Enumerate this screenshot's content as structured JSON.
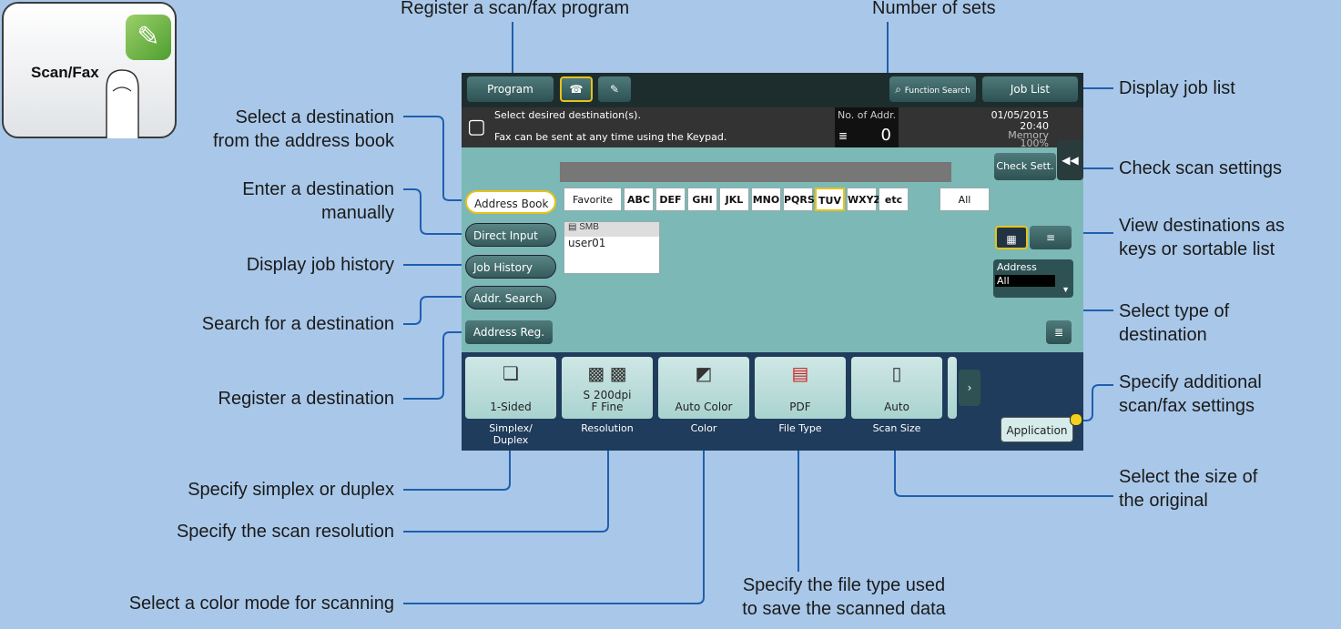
{
  "key": {
    "label": "Scan/Fax",
    "icon": "scan-fax-icon"
  },
  "toolbar": {
    "program": "Program",
    "function_search": "Function Search",
    "job_list": "Job List"
  },
  "message": {
    "line1": "Select desired destination(s).",
    "line2": "Fax can be sent at any time using the Keypad.",
    "no_of_addr_label": "No. of Addr.",
    "no_of_addr_value": "0",
    "date": "01/05/2015",
    "time": "20:40",
    "memory_label": "Memory",
    "memory_value": "100%"
  },
  "check_settings": "Check Sett.",
  "left_tabs": [
    "Address Book",
    "Direct Input",
    "Job History",
    "Addr. Search",
    "Address Reg."
  ],
  "index_tabs": [
    "Favorite",
    "ABC",
    "DEF",
    "GHI",
    "JKL",
    "MNO",
    "PQRS",
    "TUV",
    "WXYZ",
    "etc",
    "All"
  ],
  "destination": {
    "type": "SMB",
    "name": "user01"
  },
  "address_filter": {
    "label": "Address",
    "value": "All"
  },
  "functions": [
    {
      "value": "1-Sided",
      "label": "Simplex/\nDuplex"
    },
    {
      "value": "S 200dpi\nF Fine",
      "label": "Resolution"
    },
    {
      "value": "Auto Color",
      "label": "Color"
    },
    {
      "value": "PDF",
      "label": "File Type"
    },
    {
      "value": "Auto",
      "label": "Scan Size"
    }
  ],
  "application": "Application",
  "annotations": {
    "register_program": "Register a scan/fax program",
    "number_of_sets": "Number of sets",
    "display_job_list": "Display job list",
    "select_addr_book": "Select a destination\nfrom the address book",
    "enter_manually": "Enter a destination\nmanually",
    "display_history": "Display job history",
    "search_dest": "Search for a destination",
    "register_dest": "Register a destination",
    "check_scan": "Check scan settings",
    "view_dest": "View destinations as\nkeys or sortable list",
    "select_type": "Select type of\ndestination",
    "specify_additional": "Specify additional\nscan/fax settings",
    "simplex": "Specify simplex or duplex",
    "resolution": "Specify the scan resolution",
    "color_mode": "Select a color mode for scanning",
    "size_orig": "Select the size of\nthe original",
    "file_type": "Specify the file type used\nto save the scanned data"
  }
}
